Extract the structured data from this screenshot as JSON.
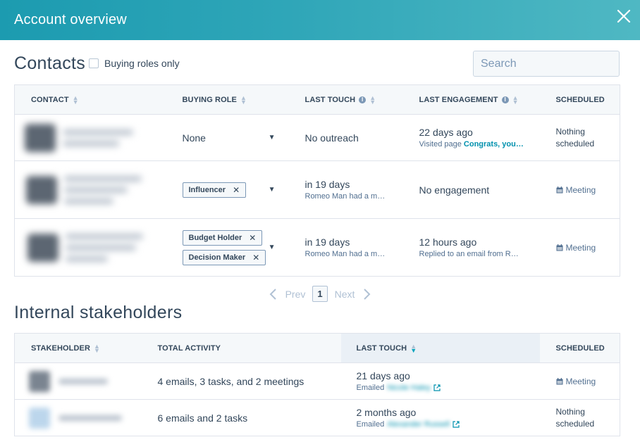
{
  "header": {
    "title": "Account overview"
  },
  "contacts": {
    "title": "Contacts",
    "checkbox_label": "Buying roles only",
    "search_placeholder": "Search",
    "columns": [
      "Contact",
      "Buying role",
      "Last touch",
      "Last engagement",
      "Scheduled"
    ],
    "rows": [
      {
        "buying_role": "None",
        "tags": [],
        "last_touch": "No outreach",
        "last_touch_detail": "",
        "engagement": "22 days ago",
        "engagement_detail": "Visited page ",
        "engagement_link": "Congrats, you…",
        "scheduled": "Nothing scheduled"
      },
      {
        "buying_role": "",
        "tags": [
          "Influencer"
        ],
        "last_touch": "in 19 days",
        "last_touch_detail": "Romeo Man had a m…",
        "engagement": "No engagement",
        "engagement_detail": "",
        "engagement_link": "",
        "scheduled": "Meeting"
      },
      {
        "buying_role": "",
        "tags": [
          "Budget Holder",
          "Decision Maker"
        ],
        "last_touch": "in 19 days",
        "last_touch_detail": "Romeo Man had a m…",
        "engagement": "12 hours ago",
        "engagement_detail": "Replied to an email from R…",
        "engagement_link": "",
        "scheduled": "Meeting"
      }
    ]
  },
  "pagination": {
    "prev": "Prev",
    "page": "1",
    "next": "Next"
  },
  "stakeholders": {
    "title": "Internal stakeholders",
    "columns": [
      "Stakeholder",
      "Total activity",
      "Last touch",
      "Scheduled"
    ],
    "rows": [
      {
        "activity": "4 emails, 3 tasks, and 2 meetings",
        "last_touch": "21 days ago",
        "emailed_label": "Emailed",
        "emailed_name": "Nicole Haley",
        "scheduled": "Meeting"
      },
      {
        "activity": "6 emails and 2 tasks",
        "last_touch": "2 months ago",
        "emailed_label": "Emailed",
        "emailed_name": "Alexander Russell",
        "scheduled": "Nothing scheduled"
      }
    ]
  },
  "colors": {
    "header_start": "#1c9bb0",
    "header_end": "#4fb8c3",
    "link": "#0091ae",
    "text": "#33475b"
  }
}
